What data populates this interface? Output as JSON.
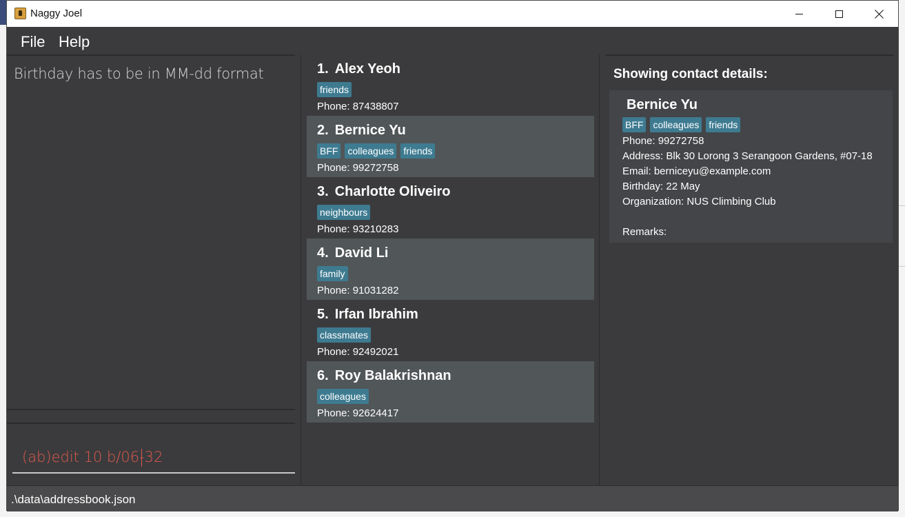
{
  "window": {
    "title": "Naggy Joel",
    "controls": {
      "minimize": "minimize",
      "maximize": "maximize",
      "close": "close"
    }
  },
  "menu": {
    "file": "File",
    "help": "Help"
  },
  "result_display": {
    "message": "Birthday has to be in MM-dd format"
  },
  "command_box": {
    "value": "(ab)edit 10 b/06-32",
    "error": true,
    "error_color": "#e05a4c"
  },
  "persons": [
    {
      "index": "1.",
      "name": "Alex Yeoh",
      "tags": [
        "friends"
      ],
      "phone": "Phone: 87438807"
    },
    {
      "index": "2.",
      "name": "Bernice Yu",
      "tags": [
        "BFF",
        "colleagues",
        "friends"
      ],
      "phone": "Phone: 99272758"
    },
    {
      "index": "3.",
      "name": "Charlotte Oliveiro",
      "tags": [
        "neighbours"
      ],
      "phone": "Phone: 93210283"
    },
    {
      "index": "4.",
      "name": "David Li",
      "tags": [
        "family"
      ],
      "phone": "Phone: 91031282"
    },
    {
      "index": "5.",
      "name": "Irfan Ibrahim",
      "tags": [
        "classmates"
      ],
      "phone": "Phone: 92492021"
    },
    {
      "index": "6.",
      "name": "Roy Balakrishnan",
      "tags": [
        "colleagues"
      ],
      "phone": "Phone: 92624417"
    }
  ],
  "details": {
    "heading": "Showing contact details:",
    "name": "Bernice Yu",
    "tags": [
      "BFF",
      "colleagues",
      "friends"
    ],
    "phone": "Phone: 99272758",
    "address": "Address: Blk 30 Lorong 3 Serangoon Gardens, #07-18",
    "email": "Email: berniceyu@example.com",
    "birthday": "Birthday: 22 May",
    "organization": "Organization: NUS Climbing Club",
    "remarks": "Remarks:"
  },
  "status_bar": {
    "path": ".\\data\\addressbook.json"
  },
  "colors": {
    "tag": "#3e7b91",
    "card_alt": "#515658",
    "background": "#3b3b3d"
  }
}
